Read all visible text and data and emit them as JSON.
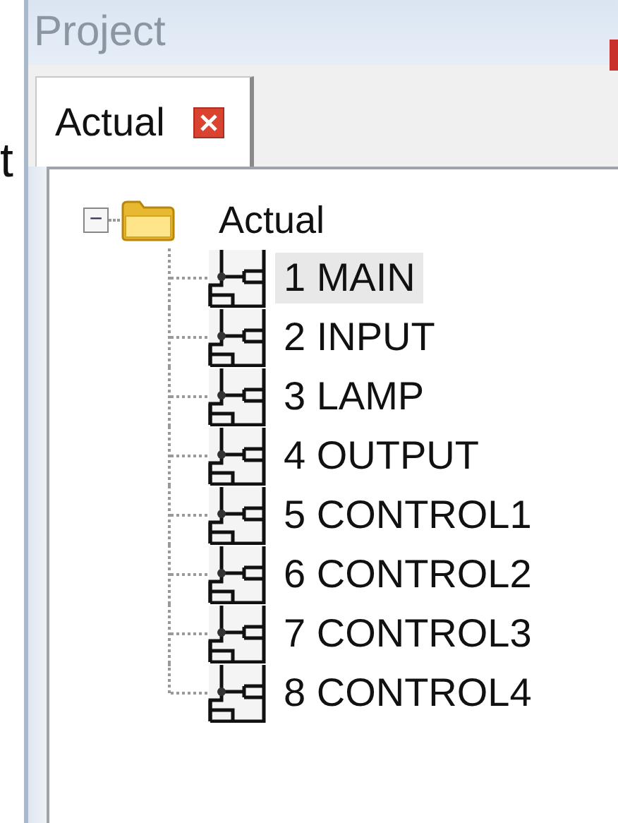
{
  "left_fragment": "t",
  "panel": {
    "title": "Project"
  },
  "tabs": [
    {
      "label": "Actual",
      "selected": true,
      "closable": true
    }
  ],
  "tree": {
    "label": "Actual",
    "expanded": true,
    "expander": "−",
    "children": [
      {
        "label": "1 MAIN",
        "selected": true
      },
      {
        "label": "2 INPUT",
        "selected": false
      },
      {
        "label": "3 LAMP",
        "selected": false
      },
      {
        "label": "4 OUTPUT",
        "selected": false
      },
      {
        "label": "5 CONTROL1",
        "selected": false
      },
      {
        "label": "6 CONTROL2",
        "selected": false
      },
      {
        "label": "7 CONTROL3",
        "selected": false
      },
      {
        "label": "8 CONTROL4",
        "selected": false
      }
    ]
  }
}
